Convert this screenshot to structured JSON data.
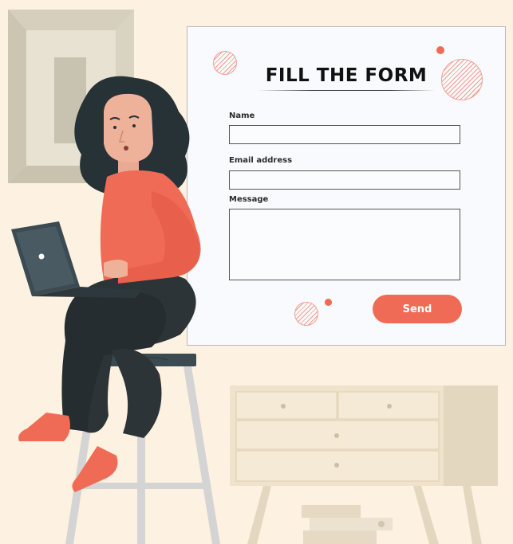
{
  "form": {
    "title": "FILL THE FORM",
    "fields": [
      {
        "label": "Name",
        "value": ""
      },
      {
        "label": "Email address",
        "value": ""
      },
      {
        "label": "Message",
        "value": ""
      }
    ],
    "send_label": "Send"
  },
  "colors": {
    "background": "#fdf2e1",
    "accent": "#f06b55",
    "panel": "#f9fafd",
    "dark": "#2d3437"
  }
}
